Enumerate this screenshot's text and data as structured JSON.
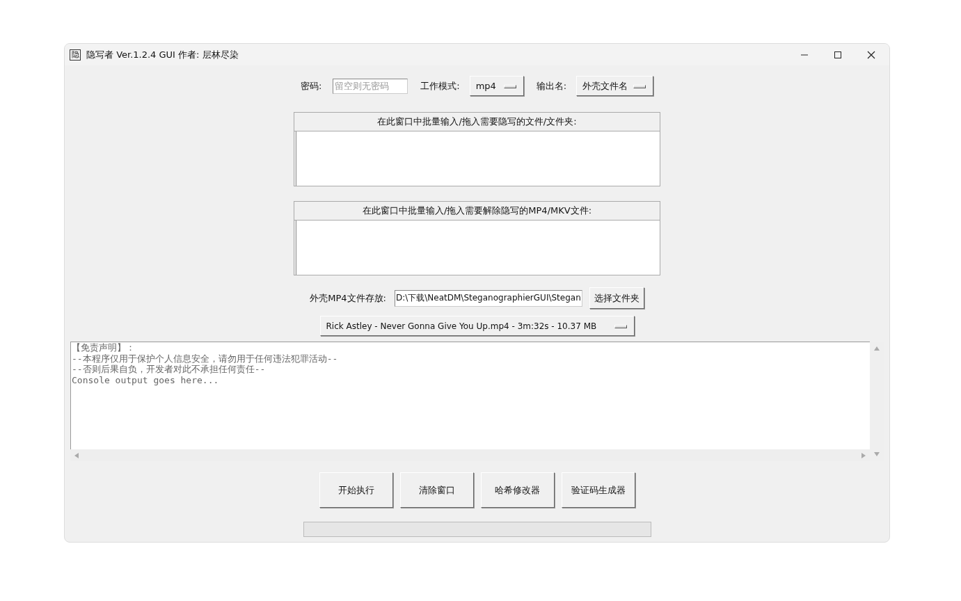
{
  "window": {
    "title": "隐写者 Ver.1.2.4 GUI 作者: 层林尽染",
    "app_icon": "隐"
  },
  "options": {
    "password_label": "密码:",
    "password_placeholder": "留空则无密码",
    "mode_label": "工作模式:",
    "mode_value": "mp4",
    "output_label": "输出名:",
    "output_value": "外壳文件名"
  },
  "encode_panel": {
    "title": "在此窗口中批量输入/拖入需要隐写的文件/文件夹:"
  },
  "decode_panel": {
    "title": "在此窗口中批量输入/拖入需要解除隐写的MP4/MKV文件:"
  },
  "cover_folder": {
    "label": "外壳MP4文件存放:",
    "value": "D:\\下载\\NeatDM\\SteganographierGUI\\Stegan",
    "button": "选择文件夹"
  },
  "cover_video": {
    "value": "Rick Astley - Never Gonna Give You Up.mp4 - 3m:32s - 10.37 MB"
  },
  "console": {
    "lines": [
      "【免责声明】：",
      "--本程序仅用于保护个人信息安全，请勿用于任何违法犯罪活动--",
      "--否则后果自负，开发者对此不承担任何责任--",
      "Console output goes here..."
    ]
  },
  "buttons": [
    "开始执行",
    "清除窗口",
    "哈希修改器",
    "验证码生成器"
  ],
  "progress": {
    "level": 0
  }
}
